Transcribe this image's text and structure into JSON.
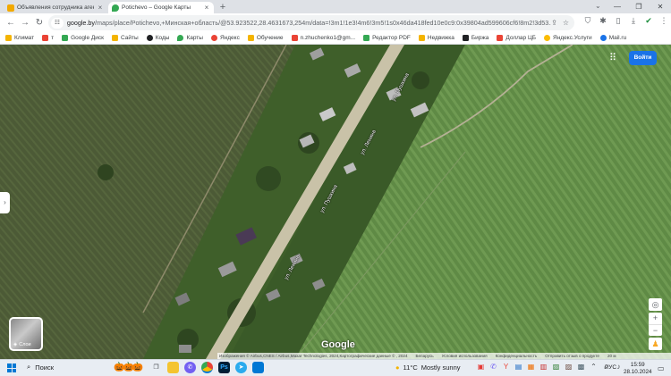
{
  "browser": {
    "tabs": [
      {
        "title": "Объявления сотрудника агентства",
        "favicon_color": "#f2a900",
        "active": false
      },
      {
        "title": "Potichevo – Google Карты",
        "favicon_color": "#34a853",
        "active": true
      }
    ],
    "new_tab_label": "+",
    "tab_close_glyph": "×",
    "window_controls": [
      "—",
      "❐",
      "✕"
    ],
    "toolbar": {
      "back": "←",
      "forward": "→",
      "reload": "↻",
      "site_chip": "☷",
      "url_host": "google.by",
      "url_rest": "/maps/place/Potichevo,+Минская+область/@53.923522,28.4631673,254m/data=!3m1!1e3!4m6!3m5!1s0x46da418fed10e0c9:0x39804ad599606cf6!8m2!3d53..."
    },
    "bookmarks": [
      {
        "label": "Климат",
        "color": "#f4b400"
      },
      {
        "label": "т",
        "color": "#ea4335"
      },
      {
        "label": "Google Диск",
        "color": "#34a853"
      },
      {
        "label": "Сайты",
        "color": "#f4b400"
      },
      {
        "label": "Коды",
        "color": "#202124"
      },
      {
        "label": "Карты",
        "color": "#34a853"
      },
      {
        "label": "Яндекс",
        "color": "#ea4335"
      },
      {
        "label": "Обучение",
        "color": "#f4b400"
      },
      {
        "label": "n.zhuchenko1@gm...",
        "color": "#ea4335"
      },
      {
        "label": "Редактор PDF",
        "color": "#34a853"
      },
      {
        "label": "Недвижка",
        "color": "#f4b400"
      },
      {
        "label": "Биржа",
        "color": "#202124"
      },
      {
        "label": "Доллар ЦБ",
        "color": "#ea4335"
      },
      {
        "label": "Яндекс.Услуги",
        "color": "#fbbc04"
      },
      {
        "label": "Mail.ru",
        "color": "#1a73e8"
      }
    ]
  },
  "map": {
    "signin_label": "Войти",
    "layers_label": "Слои",
    "google_logo": "Google",
    "street_labels": [
      {
        "text": "ул. Пушкина"
      },
      {
        "text": "ул. Ленина"
      },
      {
        "text": "ул. Пушкина"
      },
      {
        "text": "ул. Ленина"
      }
    ],
    "attribution": [
      "Изображения © Airbus,CNES / Airbus,Maxar Technologies, 2024,Картографические данные © , 2024",
      "Беларусь",
      "Условия использования",
      "Конфиденциальность",
      "Отправить отзыв о продукте",
      "20 м"
    ],
    "controls": {
      "zoom_in": "+",
      "zoom_out": "−",
      "locate": "◎",
      "pegman": "♟"
    }
  },
  "taskbar": {
    "search_label": "Поиск",
    "weather": {
      "temp": "11°C",
      "condition": "Mostly sunny"
    },
    "language": "РУС",
    "time": "15:59",
    "date": "28.10.2024"
  }
}
